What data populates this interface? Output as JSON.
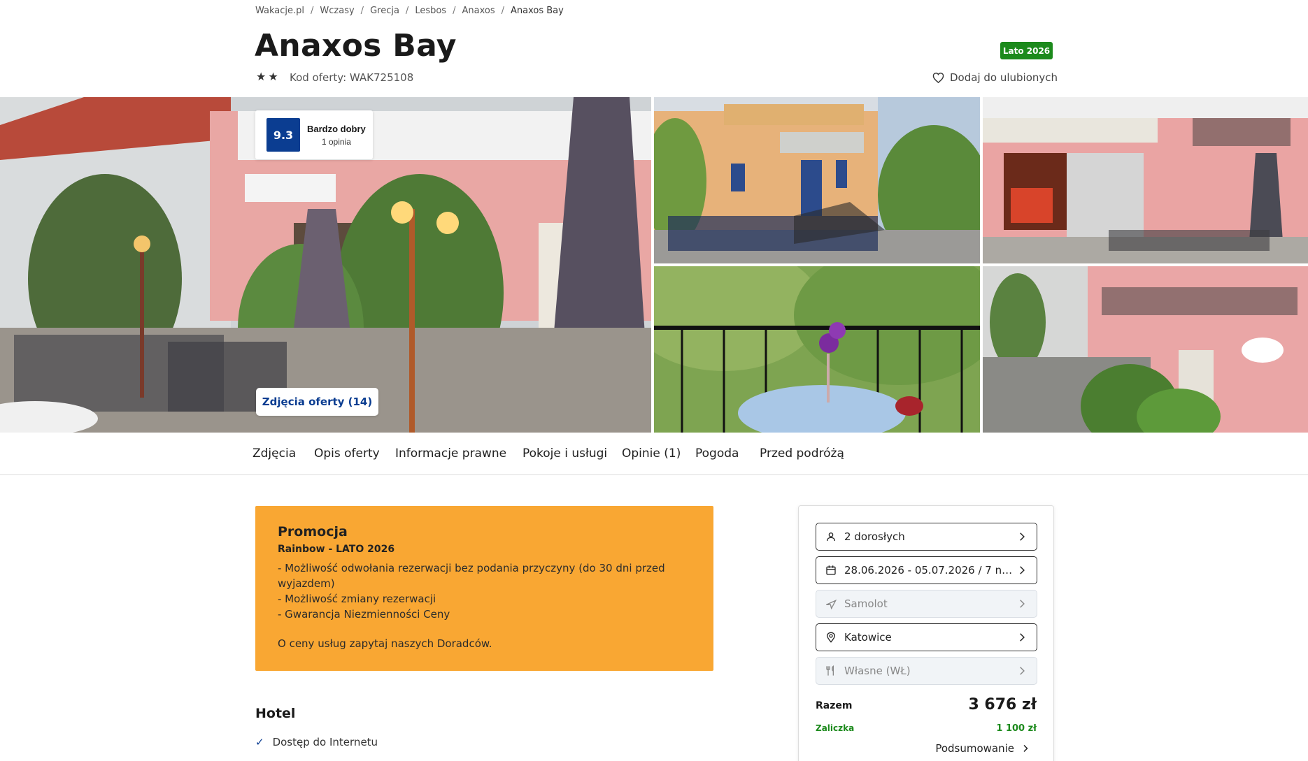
{
  "breadcrumb": [
    {
      "label": "Wakacje.pl"
    },
    {
      "label": "Wczasy"
    },
    {
      "label": "Grecja"
    },
    {
      "label": "Lesbos"
    },
    {
      "label": "Anaxos"
    },
    {
      "label": "Anaxos Bay"
    }
  ],
  "hotel": {
    "name": "Anaxos Bay",
    "stars": 2,
    "offer_code": "Kod oferty: WAK725108",
    "season_badge": "Lato 2026",
    "favorite_label": "Dodaj do ulubionych"
  },
  "rating": {
    "score": "9.3",
    "label": "Bardzo dobry",
    "count": "1 opinia"
  },
  "gallery": {
    "button_label": "Zdjęcia oferty (14)"
  },
  "tabs": [
    {
      "label": "Zdjęcia"
    },
    {
      "label": "Opis oferty"
    },
    {
      "label": "Informacje prawne"
    },
    {
      "label": "Pokoje i usługi"
    },
    {
      "label": "Opinie (1)"
    },
    {
      "label": "Pogoda"
    },
    {
      "label": "Przed podróżą"
    }
  ],
  "promo": {
    "title": "Promocja",
    "subtitle": "Rainbow - LATO 2026",
    "lines": [
      "- Możliwość odwołania rezerwacji bez podania przyczyny (do 30 dni przed",
      "wyjazdem)",
      "- Możliwość zmiany rezerwacji",
      "- Gwarancja Niezmienności Ceny"
    ],
    "footer": "O ceny usług zapytaj naszych Doradców."
  },
  "hotel_section": {
    "heading": "Hotel",
    "amenities": [
      "Dostęp do Internetu"
    ]
  },
  "booking": {
    "fields": [
      {
        "icon": "person-icon",
        "value": "2 dorosłych",
        "enabled": true
      },
      {
        "icon": "calendar-icon",
        "value": "28.06.2026 - 05.07.2026 / 7 nocy",
        "enabled": true
      },
      {
        "icon": "plane-icon",
        "value": "Samolot",
        "enabled": false
      },
      {
        "icon": "location-pin-icon",
        "value": "Katowice",
        "enabled": true
      },
      {
        "icon": "cutlery-icon",
        "value": "Własne (WŁ)",
        "enabled": false
      }
    ],
    "total_label": "Razem",
    "total_value": "3 676 zł",
    "deposit_label": "Zaliczka",
    "deposit_value": "1 100 zł",
    "summary_label": "Podsumowanie"
  },
  "colors": {
    "brand_blue": "#0b3d91",
    "promo_orange": "#f9a733",
    "badge_green": "#1c8a1c"
  }
}
